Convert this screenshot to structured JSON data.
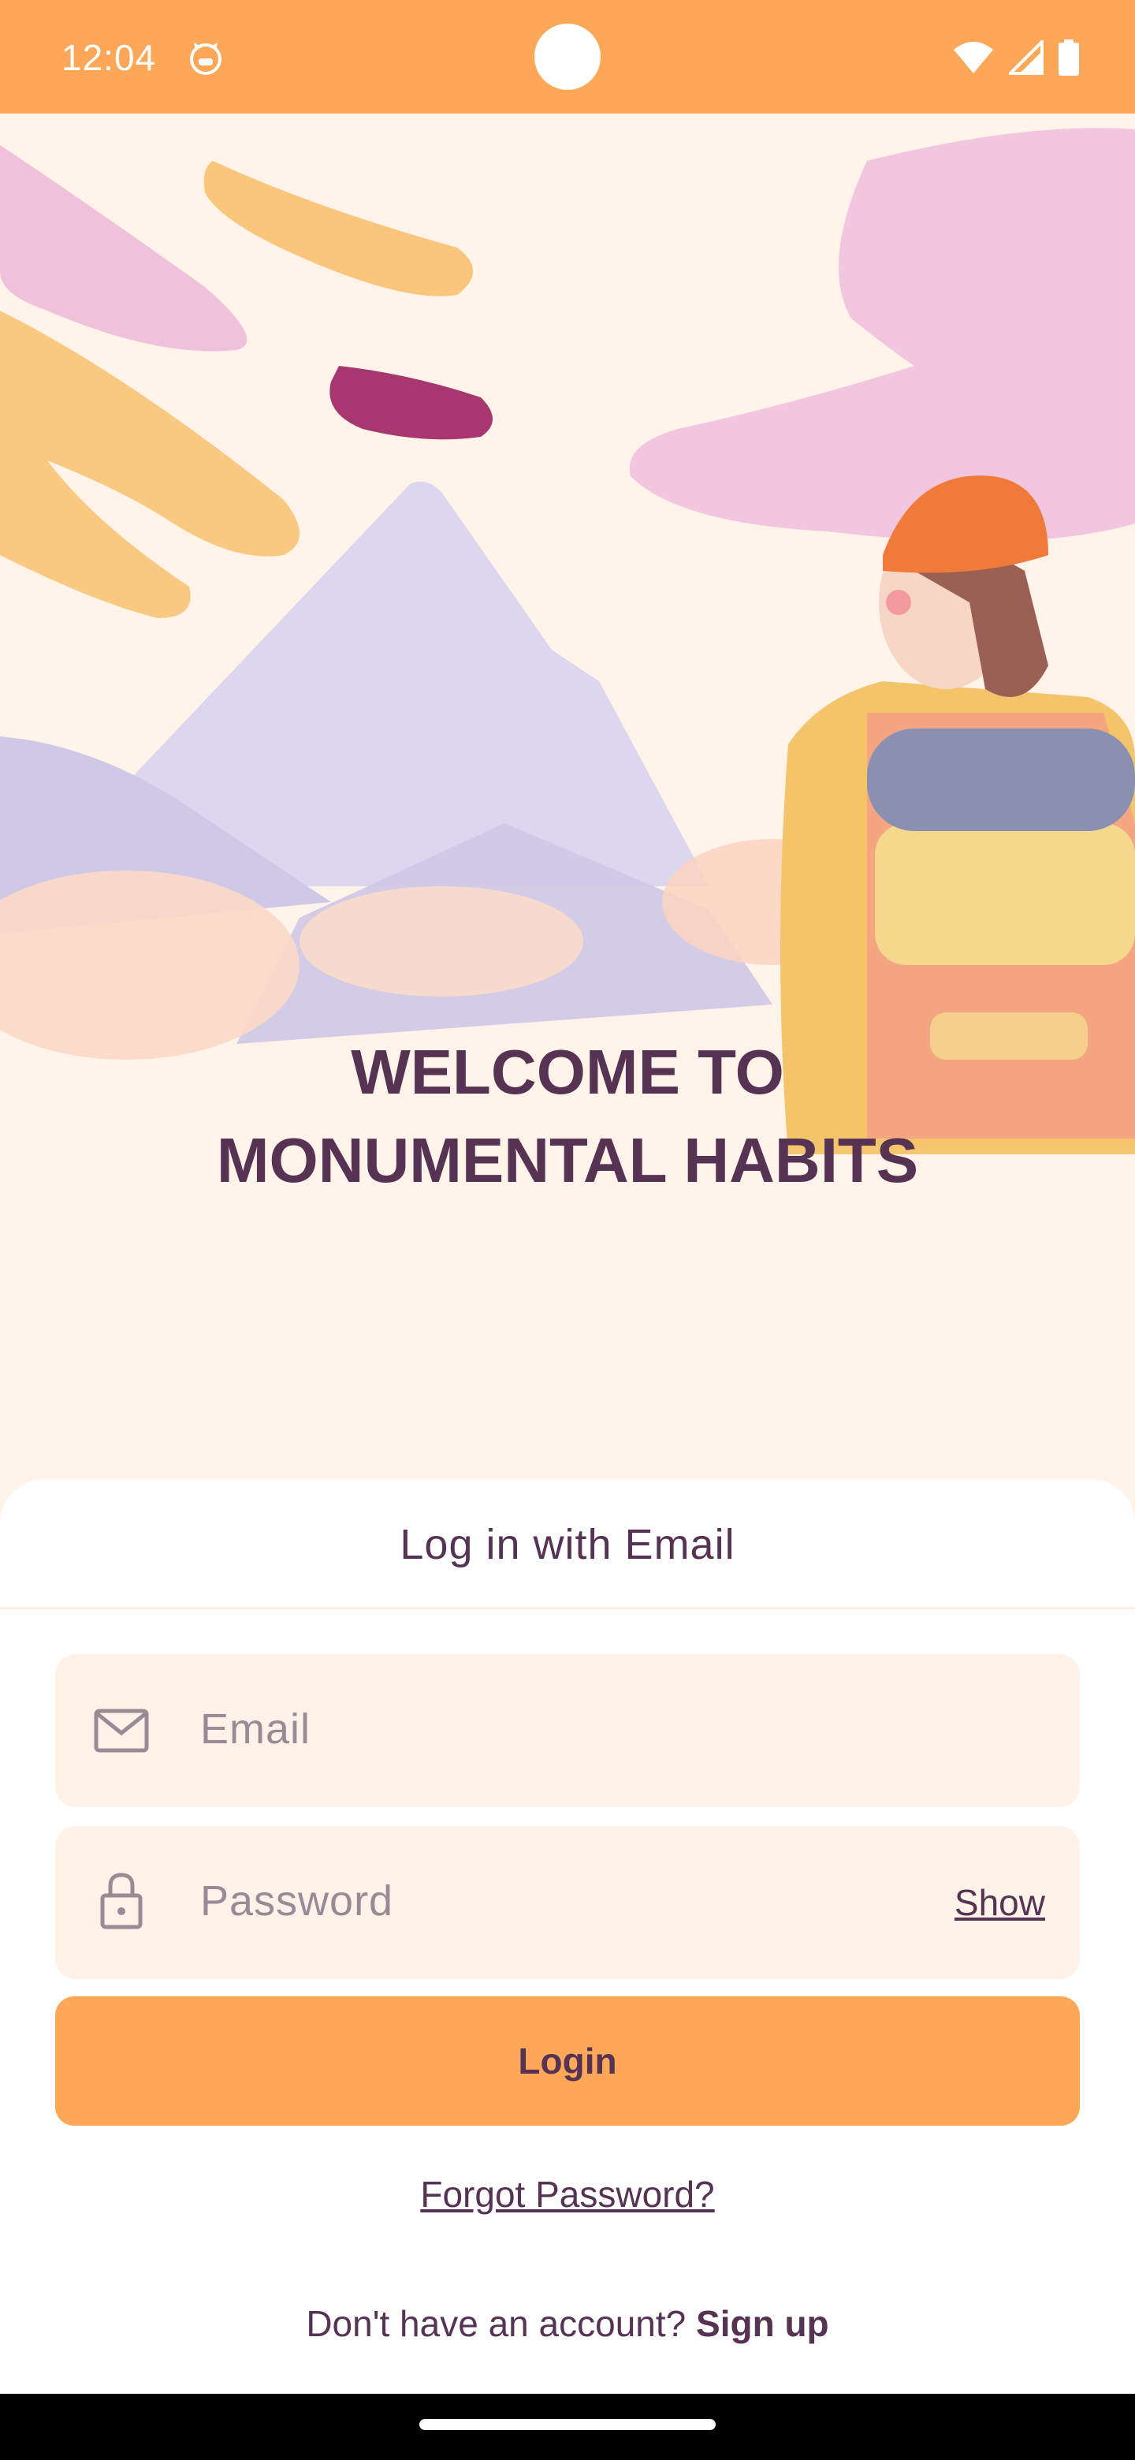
{
  "status_bar": {
    "time": "12:04",
    "icons": [
      "cat-icon",
      "wifi-icon",
      "signal-icon",
      "battery-icon"
    ]
  },
  "hero": {
    "welcome_line1": "WELCOME TO",
    "welcome_line2": "MONUMENTAL HABITS"
  },
  "login_sheet": {
    "title": "Log in with Email",
    "email": {
      "placeholder": "Email",
      "value": "",
      "icon": "mail-icon"
    },
    "password": {
      "placeholder": "Password",
      "value": "",
      "icon": "lock-icon",
      "toggle_label": "Show"
    },
    "login_label": "Login",
    "forgot_label": "Forgot Password?",
    "signup_prompt": "Don't have an account?",
    "signup_label": "Sign up"
  },
  "colors": {
    "accent": "#fda758",
    "text": "#573353",
    "background": "#fff3ea",
    "field": "#fff2e9"
  }
}
